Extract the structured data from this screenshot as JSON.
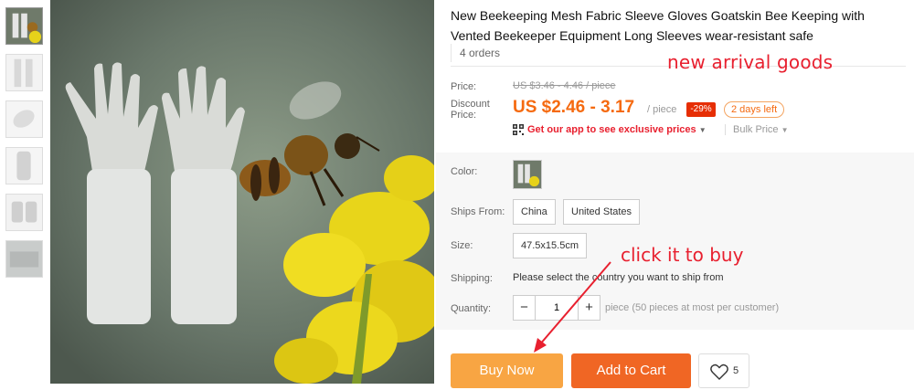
{
  "product": {
    "title": "New Beekeeping Mesh Fabric Sleeve Gloves Goatskin Bee Keeping with Vented Beekeeper Equipment Long Sleeves wear-resistant safe",
    "orders": "4 orders"
  },
  "annotations": {
    "new_arrival": "new arrival goods",
    "click_to_buy": "click it to buy"
  },
  "price": {
    "label": "Price:",
    "original": "US $3.46 - 4.46 / piece",
    "discount_label": "Discount Price:",
    "sale": "US $2.46 - 3.17",
    "per_piece": "/ piece",
    "discount_badge": "-29%",
    "days_left": "2 days left",
    "app_link": "Get our app to see exclusive prices",
    "bulk_price": "Bulk Price"
  },
  "options": {
    "color_label": "Color:",
    "ships_from_label": "Ships From:",
    "ships_from": [
      "China",
      "United States"
    ],
    "size_label": "Size:",
    "size_value": "47.5x15.5cm",
    "shipping_label": "Shipping:",
    "shipping_text": "Please select the country you want to ship from",
    "quantity_label": "Quantity:",
    "quantity_value": "1",
    "quantity_minus": "−",
    "quantity_plus": "+",
    "quantity_note": "piece (50 pieces at most per customer)"
  },
  "actions": {
    "buy_now": "Buy Now",
    "add_to_cart": "Add to Cart",
    "wishlist_count": "5"
  },
  "colors": {
    "accent_red": "#e8202f",
    "price_orange": "#f56a10",
    "buy_now_bg": "#f8a543",
    "add_to_cart_bg": "#f06624"
  }
}
